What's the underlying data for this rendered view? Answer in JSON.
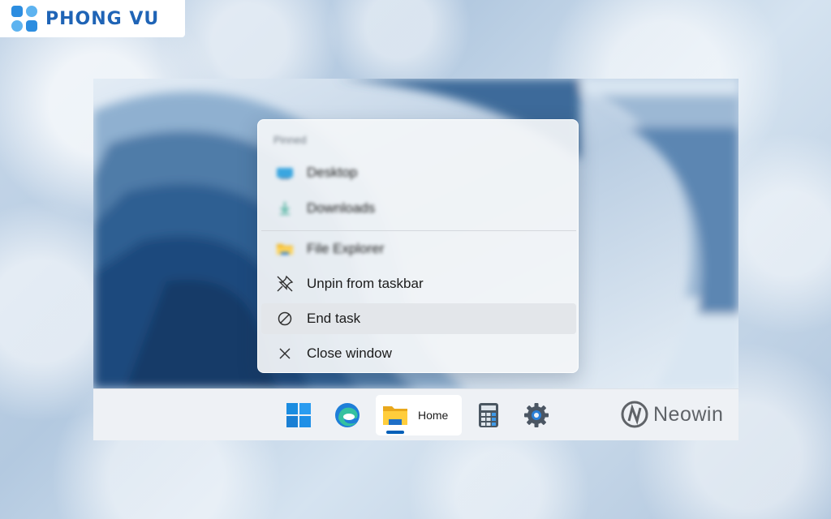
{
  "brand": {
    "name": "PHONG VU",
    "color": "#1f64b6"
  },
  "context_menu": {
    "section_title": "Pinned",
    "pinned_items": [
      {
        "label": "Desktop",
        "icon": "desktop-folder-icon"
      },
      {
        "label": "Downloads",
        "icon": "download-icon"
      }
    ],
    "app_item": {
      "label": "File Explorer",
      "icon": "file-explorer-icon"
    },
    "actions": [
      {
        "label": "Unpin from taskbar",
        "icon": "unpin-icon"
      },
      {
        "label": "End task",
        "icon": "end-task-icon",
        "highlighted": true
      },
      {
        "label": "Close window",
        "icon": "close-icon"
      }
    ]
  },
  "taskbar": {
    "items": [
      {
        "name": "start",
        "icon": "windows-start-icon"
      },
      {
        "name": "edge",
        "icon": "edge-browser-icon"
      },
      {
        "name": "file-explorer",
        "icon": "file-explorer-icon",
        "label": "Home",
        "active": true
      },
      {
        "name": "calculator",
        "icon": "calculator-icon"
      },
      {
        "name": "settings",
        "icon": "settings-gear-icon"
      }
    ]
  },
  "watermark": {
    "text": "Neowin"
  },
  "colors": {
    "accent": "#005fb8",
    "menu_bg": "#f3f5f8",
    "taskbar_bg": "#eef1f5"
  }
}
